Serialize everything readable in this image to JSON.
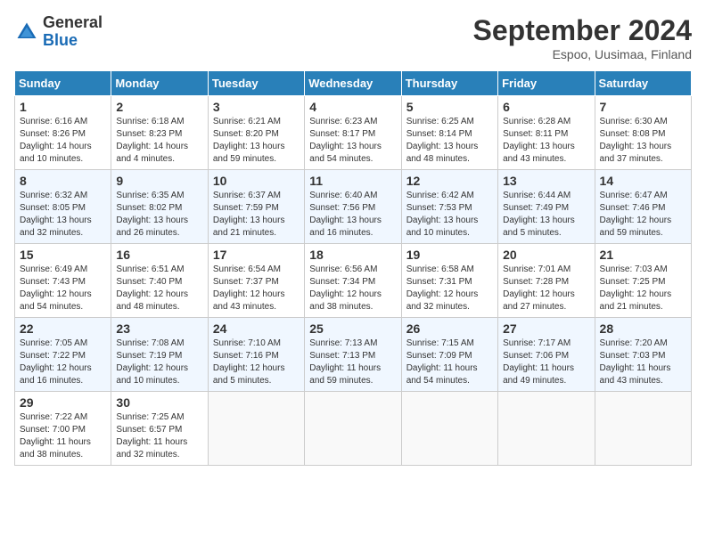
{
  "header": {
    "logo_general": "General",
    "logo_blue": "Blue",
    "month_title": "September 2024",
    "subtitle": "Espoo, Uusimaa, Finland"
  },
  "weekdays": [
    "Sunday",
    "Monday",
    "Tuesday",
    "Wednesday",
    "Thursday",
    "Friday",
    "Saturday"
  ],
  "weeks": [
    [
      {
        "day": "1",
        "sunrise": "6:16 AM",
        "sunset": "8:26 PM",
        "daylight": "14 hours and 10 minutes."
      },
      {
        "day": "2",
        "sunrise": "6:18 AM",
        "sunset": "8:23 PM",
        "daylight": "14 hours and 4 minutes."
      },
      {
        "day": "3",
        "sunrise": "6:21 AM",
        "sunset": "8:20 PM",
        "daylight": "13 hours and 59 minutes."
      },
      {
        "day": "4",
        "sunrise": "6:23 AM",
        "sunset": "8:17 PM",
        "daylight": "13 hours and 54 minutes."
      },
      {
        "day": "5",
        "sunrise": "6:25 AM",
        "sunset": "8:14 PM",
        "daylight": "13 hours and 48 minutes."
      },
      {
        "day": "6",
        "sunrise": "6:28 AM",
        "sunset": "8:11 PM",
        "daylight": "13 hours and 43 minutes."
      },
      {
        "day": "7",
        "sunrise": "6:30 AM",
        "sunset": "8:08 PM",
        "daylight": "13 hours and 37 minutes."
      }
    ],
    [
      {
        "day": "8",
        "sunrise": "6:32 AM",
        "sunset": "8:05 PM",
        "daylight": "13 hours and 32 minutes."
      },
      {
        "day": "9",
        "sunrise": "6:35 AM",
        "sunset": "8:02 PM",
        "daylight": "13 hours and 26 minutes."
      },
      {
        "day": "10",
        "sunrise": "6:37 AM",
        "sunset": "7:59 PM",
        "daylight": "13 hours and 21 minutes."
      },
      {
        "day": "11",
        "sunrise": "6:40 AM",
        "sunset": "7:56 PM",
        "daylight": "13 hours and 16 minutes."
      },
      {
        "day": "12",
        "sunrise": "6:42 AM",
        "sunset": "7:53 PM",
        "daylight": "13 hours and 10 minutes."
      },
      {
        "day": "13",
        "sunrise": "6:44 AM",
        "sunset": "7:49 PM",
        "daylight": "13 hours and 5 minutes."
      },
      {
        "day": "14",
        "sunrise": "6:47 AM",
        "sunset": "7:46 PM",
        "daylight": "12 hours and 59 minutes."
      }
    ],
    [
      {
        "day": "15",
        "sunrise": "6:49 AM",
        "sunset": "7:43 PM",
        "daylight": "12 hours and 54 minutes."
      },
      {
        "day": "16",
        "sunrise": "6:51 AM",
        "sunset": "7:40 PM",
        "daylight": "12 hours and 48 minutes."
      },
      {
        "day": "17",
        "sunrise": "6:54 AM",
        "sunset": "7:37 PM",
        "daylight": "12 hours and 43 minutes."
      },
      {
        "day": "18",
        "sunrise": "6:56 AM",
        "sunset": "7:34 PM",
        "daylight": "12 hours and 38 minutes."
      },
      {
        "day": "19",
        "sunrise": "6:58 AM",
        "sunset": "7:31 PM",
        "daylight": "12 hours and 32 minutes."
      },
      {
        "day": "20",
        "sunrise": "7:01 AM",
        "sunset": "7:28 PM",
        "daylight": "12 hours and 27 minutes."
      },
      {
        "day": "21",
        "sunrise": "7:03 AM",
        "sunset": "7:25 PM",
        "daylight": "12 hours and 21 minutes."
      }
    ],
    [
      {
        "day": "22",
        "sunrise": "7:05 AM",
        "sunset": "7:22 PM",
        "daylight": "12 hours and 16 minutes."
      },
      {
        "day": "23",
        "sunrise": "7:08 AM",
        "sunset": "7:19 PM",
        "daylight": "12 hours and 10 minutes."
      },
      {
        "day": "24",
        "sunrise": "7:10 AM",
        "sunset": "7:16 PM",
        "daylight": "12 hours and 5 minutes."
      },
      {
        "day": "25",
        "sunrise": "7:13 AM",
        "sunset": "7:13 PM",
        "daylight": "11 hours and 59 minutes."
      },
      {
        "day": "26",
        "sunrise": "7:15 AM",
        "sunset": "7:09 PM",
        "daylight": "11 hours and 54 minutes."
      },
      {
        "day": "27",
        "sunrise": "7:17 AM",
        "sunset": "7:06 PM",
        "daylight": "11 hours and 49 minutes."
      },
      {
        "day": "28",
        "sunrise": "7:20 AM",
        "sunset": "7:03 PM",
        "daylight": "11 hours and 43 minutes."
      }
    ],
    [
      {
        "day": "29",
        "sunrise": "7:22 AM",
        "sunset": "7:00 PM",
        "daylight": "11 hours and 38 minutes."
      },
      {
        "day": "30",
        "sunrise": "7:25 AM",
        "sunset": "6:57 PM",
        "daylight": "11 hours and 32 minutes."
      },
      null,
      null,
      null,
      null,
      null
    ]
  ]
}
